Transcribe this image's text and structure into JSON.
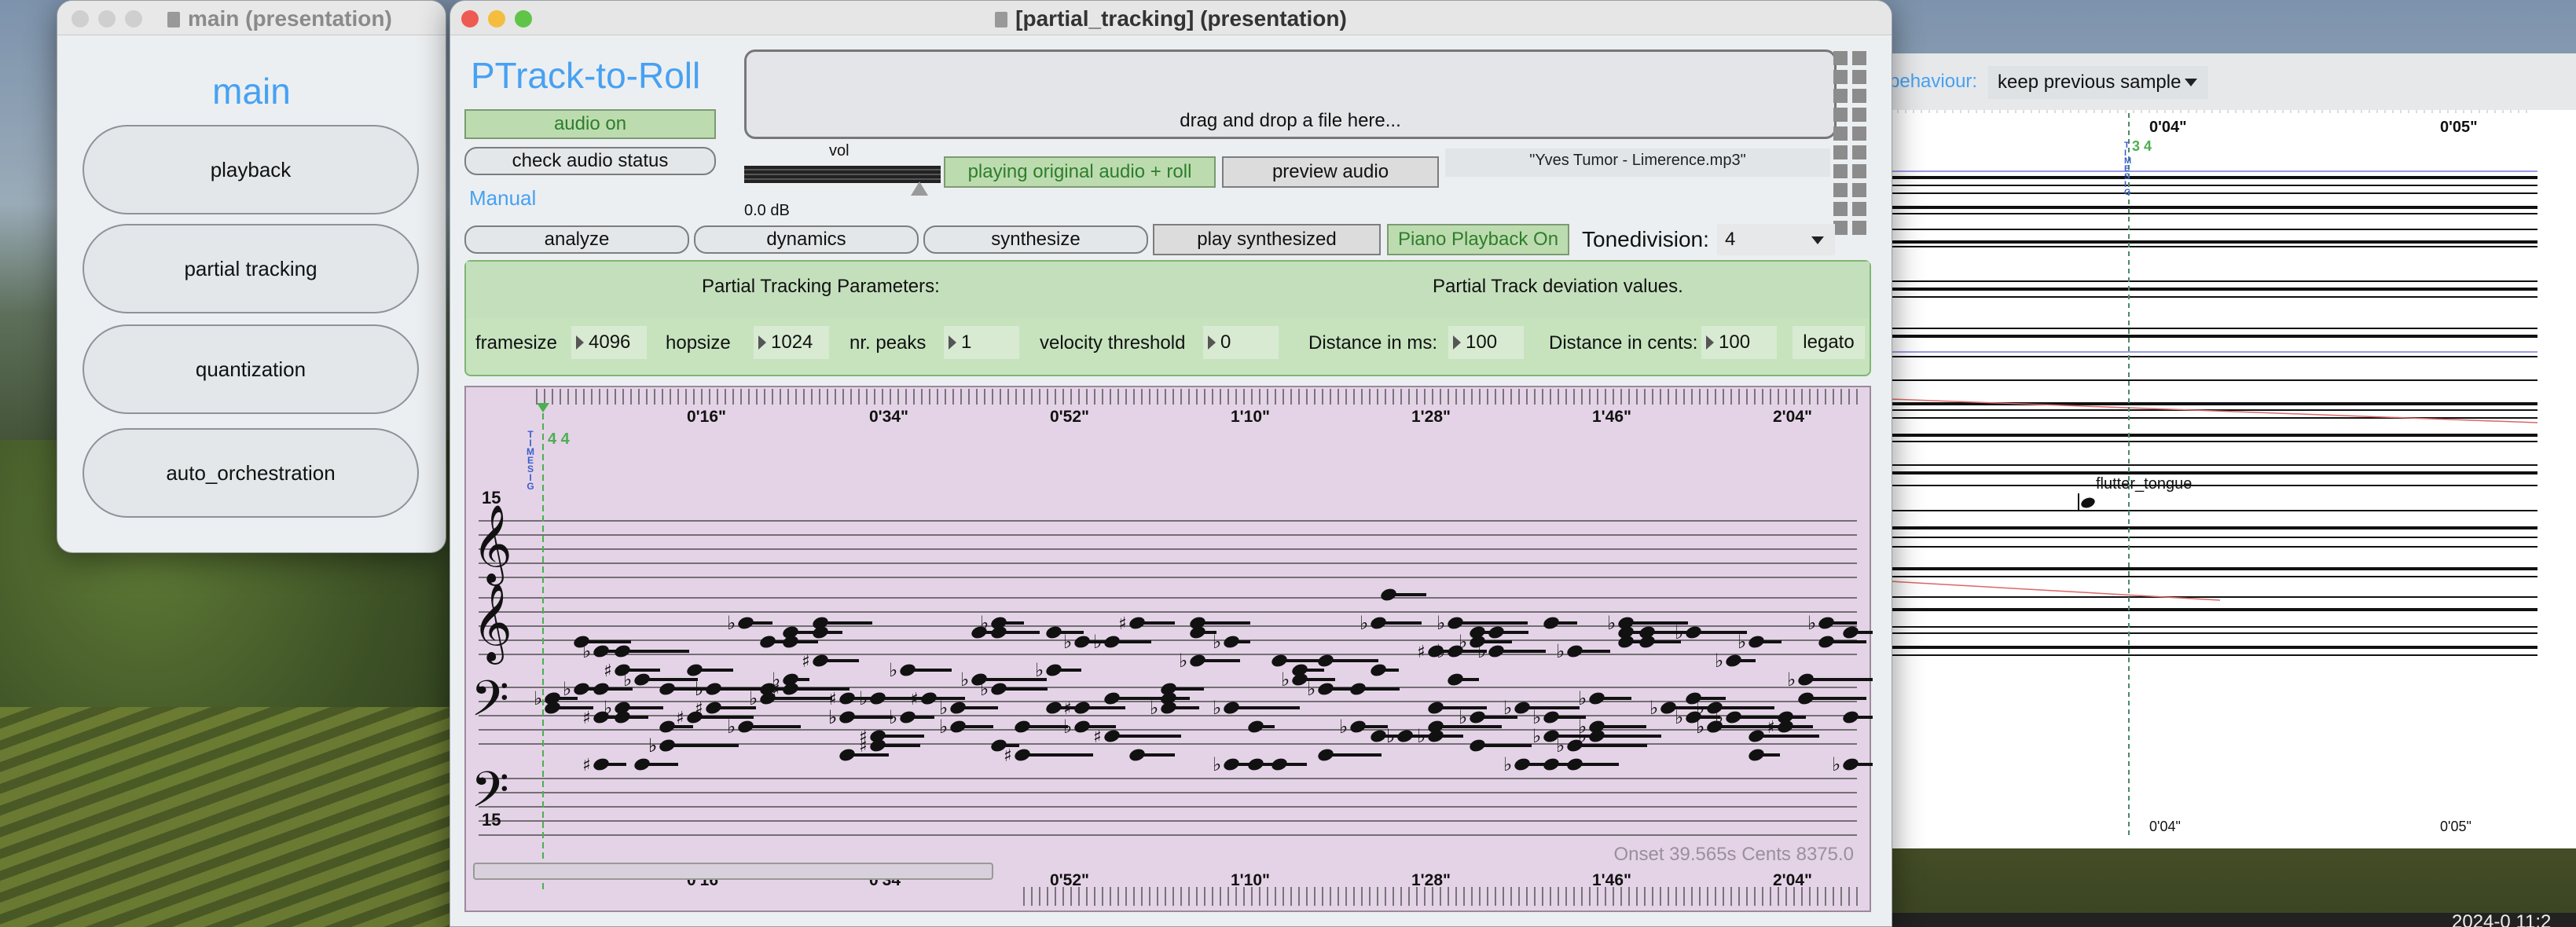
{
  "main_window": {
    "title": "main (presentation)",
    "heading": "main",
    "buttons": [
      "playback",
      "partial tracking",
      "quantization",
      "auto_orchestration"
    ]
  },
  "pt_window": {
    "title": "[partial_tracking] (presentation)",
    "app_title": "PTrack-to-Roll",
    "audio_on": "audio on",
    "check_audio": "check audio status",
    "manual": "Manual",
    "dropzone": "drag and drop a file here...",
    "vol_label": "vol",
    "vol_db": "0.0 dB",
    "playing_label": "playing original audio + roll",
    "preview_audio": "preview audio",
    "filename": "\"Yves Tumor - Limerence.mp3\"",
    "buttons": {
      "analyze": "analyze",
      "dynamics": "dynamics",
      "synthesize": "synthesize",
      "play_synth": "play synthesized",
      "piano_playback": "Piano Playback On"
    },
    "tonedivision": {
      "label": "Tonedivision:",
      "value": "4"
    },
    "params": {
      "header_left": "Partial Tracking Parameters:",
      "header_right": "Partial Track deviation values.",
      "framesize_label": "framesize",
      "framesize": "4096",
      "hopsize_label": "hopsize",
      "hopsize": "1024",
      "peaks_label": "nr. peaks",
      "peaks": "1",
      "velocity_label": "velocity threshold",
      "velocity": "0",
      "dist_ms_label": "Distance in ms:",
      "dist_ms": "100",
      "dist_cents_label": "Distance in cents:",
      "dist_cents": "100",
      "legato": "legato"
    },
    "roll": {
      "time_labels": [
        "0'16\"",
        "0'34\"",
        "0'52\"",
        "1'10\"",
        "1'28\"",
        "1'46\"",
        "2'04\""
      ],
      "time_sig": "4 4",
      "time_sig_vertical": [
        "T",
        "I",
        "M",
        "E",
        "S",
        "I",
        "G"
      ],
      "octave_marks": [
        "15",
        "15"
      ],
      "status": "Onset 39.565s   Cents 8375.0"
    }
  },
  "right_window": {
    "behaviour_label": "behaviour:",
    "behaviour_value": "keep previous sample",
    "time_labels": [
      "0'04\"",
      "0'05\""
    ],
    "time_sig": "3 4",
    "annotation": "flutter_tongue",
    "clock": "2024-0  11:2"
  },
  "colors": {
    "accent_blue": "#47a1f2",
    "green_button": "#bcdcb0",
    "params_bg": "#c6e3be",
    "roll_bg": "#e4d3e6",
    "cursor_green": "#4caf50"
  }
}
